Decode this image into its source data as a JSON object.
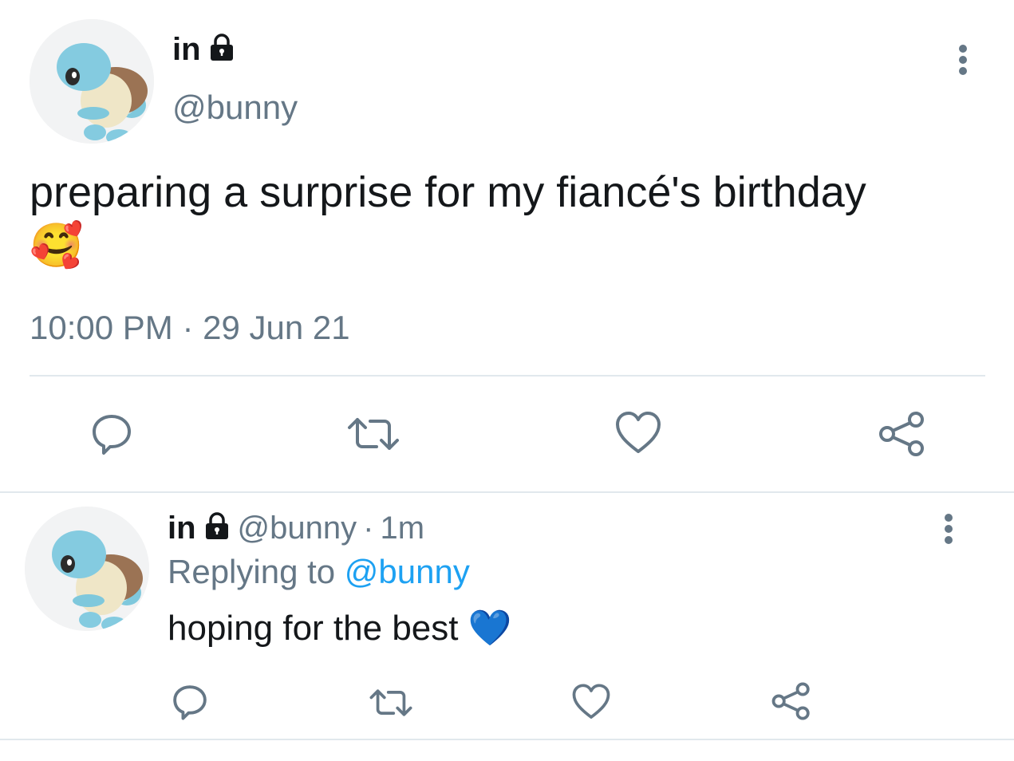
{
  "tweet": {
    "display_name": "in",
    "handle": "@bunny",
    "text": "preparing a surprise for my fiancé's birthday",
    "emoji": "🥰",
    "time": "10:00 PM",
    "separator": "·",
    "date": "29 Jun 21",
    "icons": {
      "lock": "lock-icon",
      "menu": "more-vertical-icon",
      "reply": "reply-icon",
      "retweet": "retweet-icon",
      "like": "heart-icon",
      "share": "share-icon"
    }
  },
  "reply": {
    "display_name": "in",
    "handle": "@bunny",
    "separator": "·",
    "age": "1m",
    "replying_prefix": "Replying to",
    "replying_to": "@bunny",
    "text": "hoping for the best",
    "emoji": "💙"
  },
  "colors": {
    "muted": "#657786",
    "link": "#1da1f2",
    "text": "#14171a",
    "divider": "#e1e8ed"
  }
}
